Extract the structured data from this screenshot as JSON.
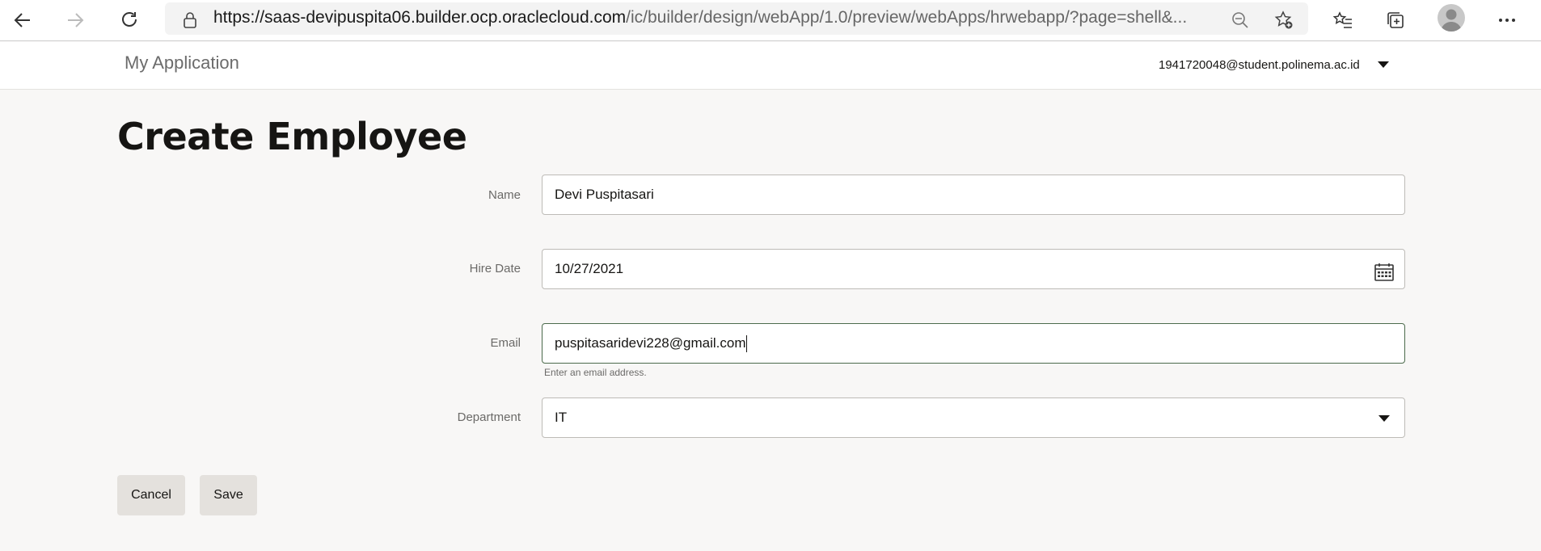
{
  "browser": {
    "url_host": "https://saas-devipuspita06.builder.ocp.oraclecloud.com",
    "url_path": "/ic/builder/design/webApp/1.0/preview/webApps/hrwebapp/?page=shell&..."
  },
  "app": {
    "title": "My Application",
    "user_email": "1941720048@student.polinema.ac.id"
  },
  "page": {
    "heading": "Create Employee"
  },
  "form": {
    "name": {
      "label": "Name",
      "value": "Devi Puspitasari"
    },
    "hire_date": {
      "label": "Hire Date",
      "value": "10/27/2021"
    },
    "email": {
      "label": "Email",
      "value": "puspitasaridevi228@gmail.com",
      "helper": "Enter an email address."
    },
    "department": {
      "label": "Department",
      "value": "IT"
    }
  },
  "actions": {
    "cancel_label": "Cancel",
    "save_label": "Save"
  },
  "colors": {
    "accent_focus": "#4c6b4c",
    "button_bg": "#e4e1dd",
    "page_bg": "#f8f7f6"
  }
}
